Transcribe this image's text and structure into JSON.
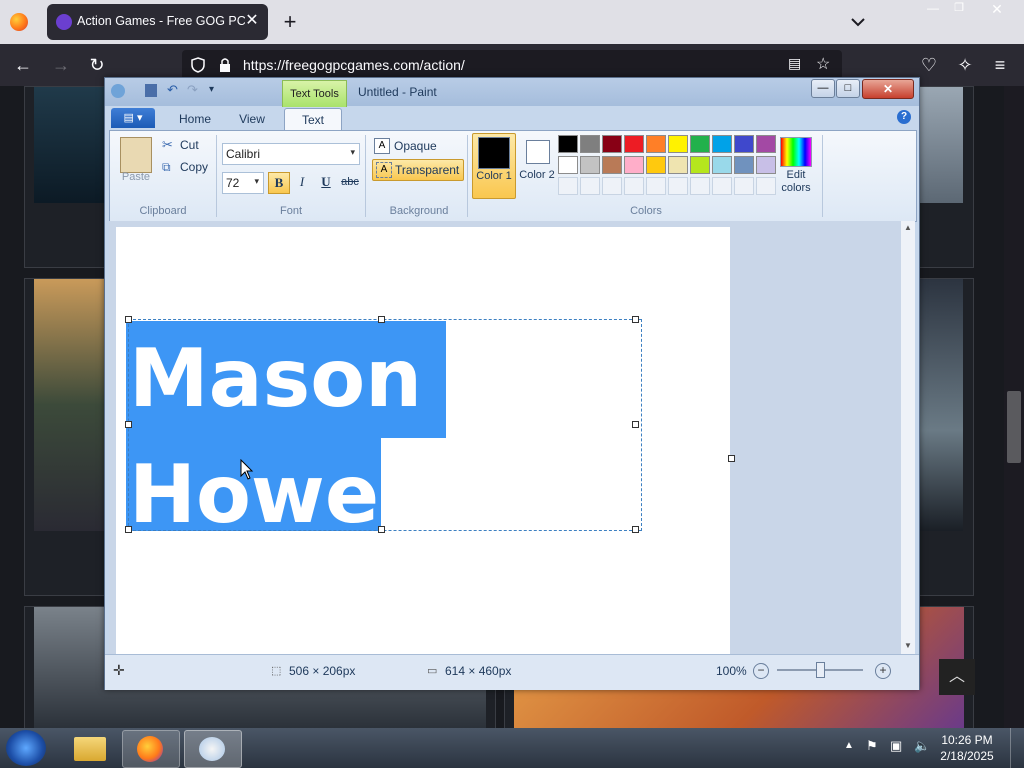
{
  "browser": {
    "tab_title": "Action Games - Free GOG PC G",
    "url": "https://freegogpcgames.com/action/",
    "tab_close": "✕",
    "new_tab": "+"
  },
  "paint": {
    "context_tab": "Text Tools",
    "title": "Untitled - Paint",
    "tabs": [
      "Home",
      "View",
      "Text"
    ],
    "clipboard": {
      "paste": "Paste",
      "cut": "Cut",
      "copy": "Copy",
      "label": "Clipboard"
    },
    "font": {
      "family": "Calibri",
      "size": "72",
      "bold": "B",
      "italic": "I",
      "underline": "U",
      "strike": "abc",
      "label": "Font"
    },
    "background": {
      "opaque": "Opaque",
      "transparent": "Transparent",
      "label": "Background"
    },
    "colors": {
      "color1_label": "Color 1",
      "color2_label": "Color 2",
      "edit_label": "Edit colors",
      "label": "Colors",
      "color1": "#000000",
      "color2": "#ffffff",
      "palette_row1": [
        "#000000",
        "#7f7f7f",
        "#880015",
        "#ed1c24",
        "#ff7f27",
        "#fff200",
        "#22b14c",
        "#00a2e8",
        "#3f48cc",
        "#a349a4"
      ],
      "palette_row2": [
        "#ffffff",
        "#c3c3c3",
        "#b97a57",
        "#ffaec9",
        "#ffc90e",
        "#efe4b0",
        "#b5e61d",
        "#99d9ea",
        "#7092be",
        "#c8bfe7"
      ]
    },
    "canvas_text_line1": "Mason",
    "canvas_text_line2": "Howe",
    "selection_size": "506 × 206px",
    "canvas_size": "614 × 460px",
    "zoom": "100%"
  },
  "taskbar": {
    "time": "10:26 PM",
    "date": "2/18/2025"
  }
}
